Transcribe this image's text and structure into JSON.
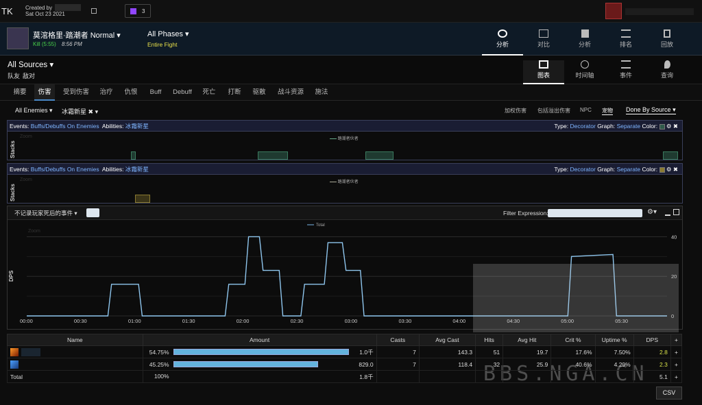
{
  "top": {
    "initials": "TK",
    "created_by": "Created by",
    "date": "Sat Oct 23 2021",
    "badge_count": "3"
  },
  "header": {
    "fight_name": "莫涫格里·踏潮者 Normal",
    "kill_text": "Kill (5:55)",
    "time": "8:56 PM",
    "phases": "All Phases",
    "phase_sub": "Entire Fight",
    "nav": [
      {
        "label": "分析"
      },
      {
        "label": "对比"
      },
      {
        "label": "分析"
      },
      {
        "label": "排名"
      },
      {
        "label": "回放"
      }
    ]
  },
  "sources": {
    "title": "All Sources",
    "friendly": "队友",
    "enemy": "敌对",
    "views": [
      {
        "label": "图表"
      },
      {
        "label": "时间轴"
      },
      {
        "label": "事件"
      },
      {
        "label": "查询"
      }
    ]
  },
  "tabs": [
    "摘要",
    "伤害",
    "受到伤害",
    "治疗",
    "仇恨",
    "Buff",
    "Debuff",
    "死亡",
    "打断",
    "驱散",
    "战斗资源",
    "施法"
  ],
  "filters": {
    "enemies": "All Enemies",
    "ability": "冰霜新星",
    "close": "✖",
    "opts": [
      "加权伤害",
      "包括溢出伤害",
      "NPC",
      "宠物"
    ],
    "done_by": "Done By Source"
  },
  "panels": [
    {
      "events_label": "Events:",
      "events": "Buffs/Debuffs On Enemies",
      "abilities_label": "Abilities:",
      "abilities": "冰霜新星",
      "type_label": "Type:",
      "type": "Decorator",
      "graph_label": "Graph:",
      "graph": "Separate",
      "color_label": "Color:",
      "color": "#2e5a4a",
      "ylabel": "Stacks",
      "zoom": "Zoom",
      "legend": "踏潮者伙者"
    },
    {
      "events_label": "Events:",
      "events": "Buffs/Debuffs On Enemies",
      "abilities_label": "Abilities:",
      "abilities": "冰霜新星",
      "type_label": "Type:",
      "type": "Decorator",
      "graph_label": "Graph:",
      "graph": "Separate",
      "color_label": "Color:",
      "color": "#8a7a30",
      "ylabel": "Stacks",
      "zoom": "Zoom",
      "legend": "踏潮者伙者"
    }
  ],
  "main": {
    "dropdown": "不记录玩家死后的事件",
    "filter_label": "Filter Expression:",
    "zoom": "Zoom",
    "ylabel": "DPS",
    "legend": "Total"
  },
  "chart_data": {
    "type": "line",
    "x_labels": [
      "00:00",
      "00:30",
      "01:00",
      "01:30",
      "02:00",
      "02:30",
      "03:00",
      "03:30",
      "04:00",
      "04:30",
      "05:00",
      "05:30"
    ],
    "y_ticks": [
      "40",
      "20",
      "0"
    ],
    "ylim": [
      0,
      45
    ],
    "xlim": [
      0,
      355
    ],
    "series": [
      {
        "name": "Total",
        "x": [
          0,
          45,
          47,
          62,
          64,
          110,
          112,
          121,
          123,
          129,
          131,
          140,
          142,
          152,
          154,
          165,
          167,
          175,
          177,
          185,
          187,
          210,
          212,
          235,
          237,
          240,
          300,
          302,
          325,
          327,
          355
        ],
        "y": [
          0,
          0,
          16,
          16,
          0,
          0,
          16,
          16,
          40,
          40,
          23,
          23,
          0,
          0,
          16,
          16,
          37,
          37,
          23,
          23,
          0,
          0,
          0,
          0,
          0,
          0,
          0,
          30,
          31,
          0,
          0
        ]
      }
    ]
  },
  "table": {
    "headers": [
      "Name",
      "Amount",
      "Casts",
      "Avg Cast",
      "Hits",
      "Avg Hit",
      "Crit %",
      "Uptime %",
      "DPS",
      "+"
    ],
    "rows": [
      {
        "pct": "54.75%",
        "bar": 0.5475,
        "amount": "1.0千",
        "casts": "7",
        "avg_cast": "143.3",
        "hits": "51",
        "avg_hit": "19.7",
        "crit": "17.6%",
        "uptime": "7.50%",
        "dps": "2.8",
        "plus": "+",
        "icon": "fire-icon"
      },
      {
        "pct": "45.25%",
        "bar": 0.4525,
        "amount": "829.0",
        "casts": "7",
        "avg_cast": "118.4",
        "hits": "32",
        "avg_hit": "25.9",
        "crit": "40.6%",
        "uptime": "4.29%",
        "dps": "2.3",
        "plus": "+",
        "icon": "frost-icon"
      }
    ],
    "total": {
      "name": "Total",
      "pct": "100%",
      "amount": "1.8千",
      "dps": "5.1",
      "plus": "+"
    }
  },
  "csv": "CSV",
  "watermark": "BBS.NGA.CN"
}
